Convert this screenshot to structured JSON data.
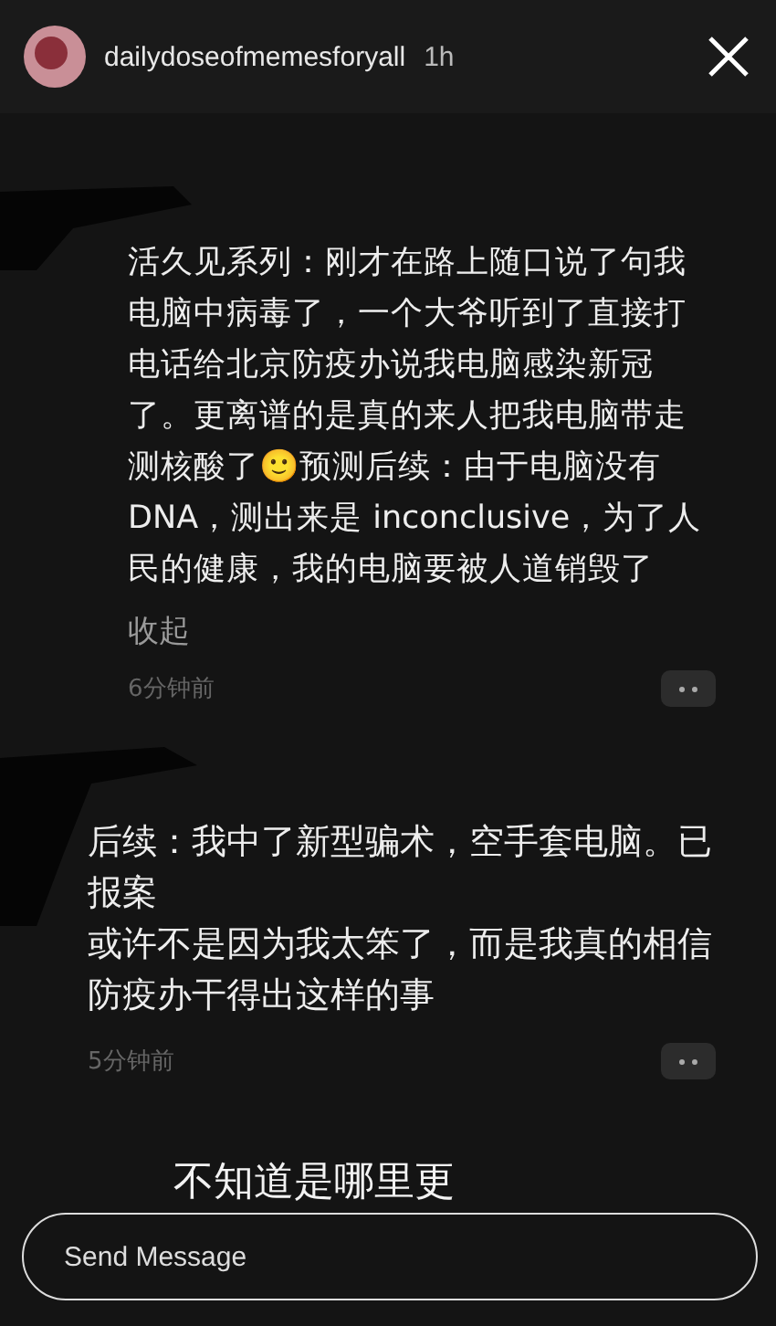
{
  "header": {
    "username": "dailydoseofmemesforyall",
    "time": "1h"
  },
  "comments": [
    {
      "text": "活久见系列：刚才在路上随口说了句我电脑中病毒了，一个大爷听到了直接打电话给北京防疫办说我电脑感染新冠了。更离谱的是真的来人把我电脑带走测核酸了🙂预测后续：由于电脑没有 DNA，测出来是 inconclusive，为了人民的健康，我的电脑要被人道销毁了",
      "collapse": "收起",
      "time": "6分钟前"
    },
    {
      "paragraphs": [
        "后续：我中了新型骗术，空手套电脑。已报案",
        "或许不是因为我太笨了，而是我真的相信防疫办干得出这样的事"
      ],
      "time": "5分钟前"
    }
  ],
  "caption": "不知道是哪里更",
  "message_field": {
    "placeholder": "Send Message"
  }
}
